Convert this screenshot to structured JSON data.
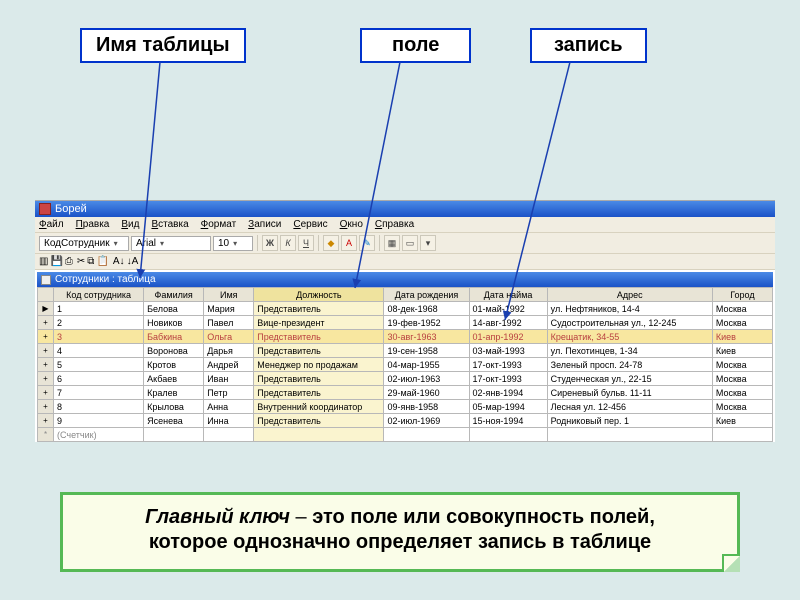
{
  "labels": {
    "table_name": "Имя таблицы",
    "field": "поле",
    "record": "запись"
  },
  "window": {
    "title": "Борей",
    "menu": [
      "Файл",
      "Правка",
      "Вид",
      "Вставка",
      "Формат",
      "Записи",
      "Сервис",
      "Окно",
      "Справка"
    ],
    "toolbar": {
      "field_selector": "КодСотрудник",
      "font": "Arial",
      "size": "10"
    },
    "subwindow_title": "Сотрудники : таблица",
    "columns": [
      "Код сотрудника",
      "Фамилия",
      "Имя",
      "Должность",
      "Дата рождения",
      "Дата найма",
      "Адрес",
      "Город"
    ],
    "rows": [
      {
        "id": "1",
        "fam": "Белова",
        "name": "Мария",
        "pos": "Представитель",
        "dob": "08-дек-1968",
        "hire": "01-май-1992",
        "addr": "ул. Нефтяников, 14-4",
        "city": "Москва"
      },
      {
        "id": "2",
        "fam": "Новиков",
        "name": "Павел",
        "pos": "Вице-президент",
        "dob": "19-фев-1952",
        "hire": "14-авг-1992",
        "addr": "Судостроительная ул., 12-245",
        "city": "Москва"
      },
      {
        "id": "3",
        "fam": "Бабкина",
        "name": "Ольга",
        "pos": "Представитель",
        "dob": "30-авг-1963",
        "hire": "01-апр-1992",
        "addr": "Крещатик, 34-55",
        "city": "Киев"
      },
      {
        "id": "4",
        "fam": "Воронова",
        "name": "Дарья",
        "pos": "Представитель",
        "dob": "19-сен-1958",
        "hire": "03-май-1993",
        "addr": "ул. Пехотинцев, 1-34",
        "city": "Киев"
      },
      {
        "id": "5",
        "fam": "Кротов",
        "name": "Андрей",
        "pos": "Менеджер по продажам",
        "dob": "04-мар-1955",
        "hire": "17-окт-1993",
        "addr": "Зеленый просп. 24-78",
        "city": "Москва"
      },
      {
        "id": "6",
        "fam": "Акбаев",
        "name": "Иван",
        "pos": "Представитель",
        "dob": "02-июл-1963",
        "hire": "17-окт-1993",
        "addr": "Студенческая ул., 22-15",
        "city": "Москва"
      },
      {
        "id": "7",
        "fam": "Кралев",
        "name": "Петр",
        "pos": "Представитель",
        "dob": "29-май-1960",
        "hire": "02-янв-1994",
        "addr": "Сиреневый бульв. 11-11",
        "city": "Москва"
      },
      {
        "id": "8",
        "fam": "Крылова",
        "name": "Анна",
        "pos": "Внутренний координатор",
        "dob": "09-янв-1958",
        "hire": "05-мар-1994",
        "addr": "Лесная ул. 12-456",
        "city": "Москва"
      },
      {
        "id": "9",
        "fam": "Ясенева",
        "name": "Инна",
        "pos": "Представитель",
        "dob": "02-июл-1969",
        "hire": "15-ноя-1994",
        "addr": "Родниковый пер. 1",
        "city": "Киев"
      }
    ],
    "counter_label": "(Счетчик)",
    "highlight_column_index": 3,
    "highlight_row_index": 2
  },
  "definition": {
    "term": "Главный ключ",
    "dash": " – ",
    "rest1": "это поле или совокупность полей,",
    "rest2": "которое однозначно определяет запись в таблице"
  }
}
